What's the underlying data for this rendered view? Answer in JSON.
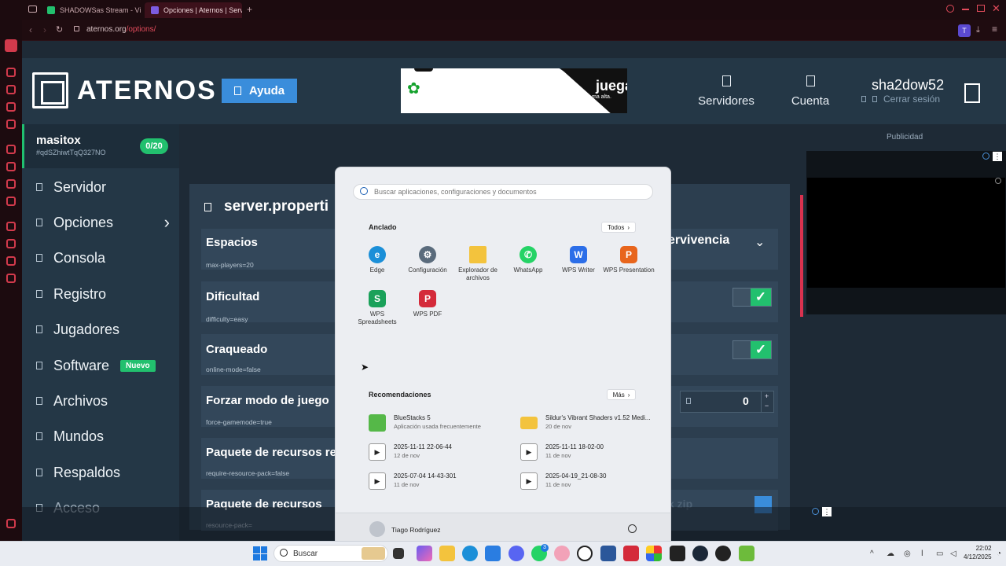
{
  "browser": {
    "tabs": [
      {
        "label": "SHADOWSas Stream - Vi",
        "color": "#22c06e"
      },
      {
        "label": "Opciones | Aternos | Serv",
        "color": "#7c5ce0"
      }
    ],
    "new_tab": "+",
    "url_host": "aternos.org",
    "url_path": "/options/",
    "profile_initial": "T"
  },
  "header": {
    "logo_text": "ATERNOS",
    "help_label": "Ayuda",
    "ad_text": "juega.",
    "ad_subtext": "ma alta.",
    "servers_label": "Servidores",
    "account_label": "Cuenta",
    "username": "sha2dow52",
    "logout_label": "Cerrar sesión"
  },
  "server": {
    "name": "masitox",
    "id": "#qdSZhiwtTqQ327NO",
    "players": "0/20"
  },
  "sidebar": {
    "items": [
      {
        "label": "Servidor"
      },
      {
        "label": "Opciones"
      },
      {
        "label": "Consola"
      },
      {
        "label": "Registro"
      },
      {
        "label": "Jugadores"
      },
      {
        "label": "Software",
        "badge": "Nuevo"
      },
      {
        "label": "Archivos"
      },
      {
        "label": "Mundos"
      },
      {
        "label": "Respaldos"
      },
      {
        "label": "Acceso"
      }
    ]
  },
  "main": {
    "title": "server.properti",
    "rows": [
      {
        "label": "Espacios",
        "key": "max-players=20"
      },
      {
        "label": "Dificultad",
        "key": "difficulty=easy"
      },
      {
        "label": "Craqueado",
        "key": "online-mode=false"
      },
      {
        "label": "Forzar modo de juego",
        "key": "force-gamemode=true"
      },
      {
        "label": "Paquete de recursos re",
        "key": "require-resource-pack=false"
      },
      {
        "label": "Paquete de recursos",
        "key": "resource-pack="
      }
    ],
    "gamemode_select": "ervivencia",
    "number_value": "0",
    "zip_placeholder": "k zip",
    "toggle_check": "✓"
  },
  "ads": {
    "label": "Publicidad"
  },
  "start_menu": {
    "search_placeholder": "Buscar aplicaciones, configuraciones y documentos",
    "pinned_title": "Anclado",
    "all_button": "Todos",
    "pinned": [
      {
        "label": "Edge",
        "icon": "edge-icon",
        "color": "#1b8fd8"
      },
      {
        "label": "Configuración",
        "icon": "gear-icon",
        "color": "#5a6b7c"
      },
      {
        "label": "Explorador de archivos",
        "icon": "folder-icon",
        "color": "#f3c33d"
      },
      {
        "label": "WhatsApp",
        "icon": "whatsapp-icon",
        "color": "#25d366"
      },
      {
        "label": "WPS Writer",
        "icon": "wps-writer-icon",
        "color": "#2c6ee8"
      },
      {
        "label": "WPS Presentation",
        "icon": "wps-presentation-icon",
        "color": "#e8651c"
      },
      {
        "label": "WPS Spreadsheets",
        "icon": "wps-spreadsheets-icon",
        "color": "#1aa15a"
      },
      {
        "label": "WPS PDF",
        "icon": "wps-pdf-icon",
        "color": "#d42a3a"
      }
    ],
    "rec_title": "Recomendaciones",
    "more_button": "Más",
    "recommendations": [
      {
        "name": "BlueStacks 5",
        "sub": "Aplicación usada frecuentemente",
        "icon": "bluestacks-icon"
      },
      {
        "name": "Sildur's Vibrant Shaders v1.52 Medi...",
        "sub": "20 de nov",
        "icon": "folder-icon"
      },
      {
        "name": "2025-11-11 22-06-44",
        "sub": "12 de nov",
        "icon": "video-file-icon"
      },
      {
        "name": "2025-11-11 18-02-00",
        "sub": "11 de nov",
        "icon": "video-file-icon"
      },
      {
        "name": "2025-07-04 14-43-301",
        "sub": "11 de nov",
        "icon": "video-file-icon"
      },
      {
        "name": "2025-04-19_21-08-30",
        "sub": "11 de nov",
        "icon": "video-file-icon"
      }
    ],
    "user_name": "Tiago Rodríguez"
  },
  "taskbar": {
    "search_label": "Buscar",
    "time": "22:02",
    "date": "4/12/2025",
    "whatsapp_badge": "3"
  }
}
